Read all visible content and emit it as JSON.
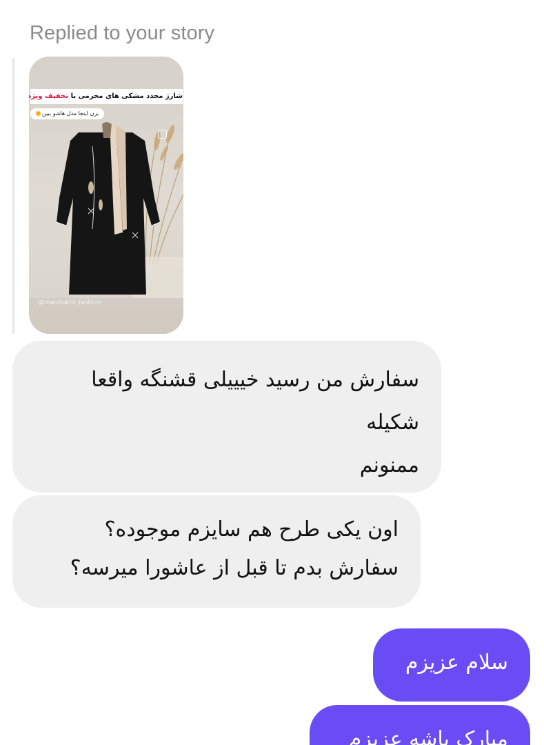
{
  "story_reply": {
    "caption": "Replied to your story",
    "thumbnail": {
      "banner_prefix": "شارژ مجدد مشکی های محرمی با",
      "banner_highlight": "تخفیف ویژه",
      "pill_text": "بزن اینجا مدل هاشو ببین",
      "watermark": "@mahdokht_fashion"
    }
  },
  "messages": [
    {
      "direction": "incoming",
      "lines": [
        "سفارش من رسید خیییلی قشنگه واقعا",
        "شکیله",
        "ممنونم"
      ]
    },
    {
      "direction": "incoming",
      "lines": [
        "اون یکی طرح هم سایزم موجوده؟",
        "سفارش بدم تا قبل از عاشورا میرسه؟"
      ]
    },
    {
      "direction": "outgoing",
      "lines": [
        "سلام عزیزم"
      ]
    },
    {
      "direction": "outgoing",
      "lines": [
        "مبارک باشه عزیزم"
      ]
    }
  ],
  "colors": {
    "incoming_bubble": "#efefef",
    "outgoing_bubble": "#6a4cf5",
    "caption_text": "#8a8a8a"
  }
}
